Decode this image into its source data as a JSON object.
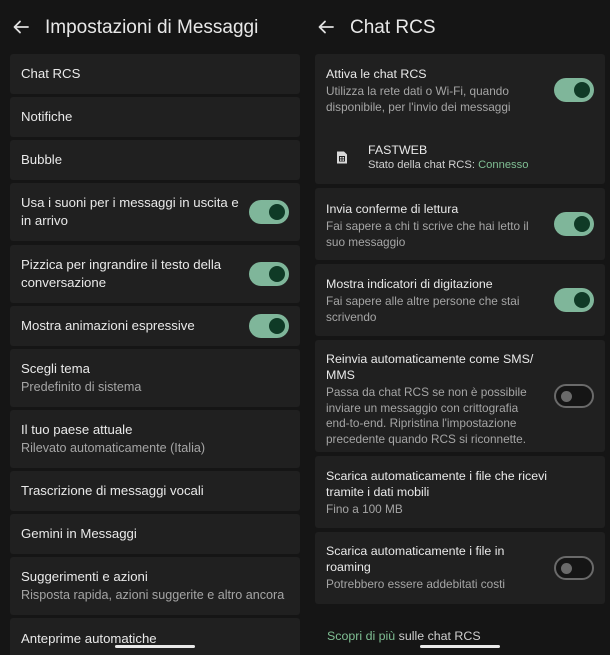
{
  "left": {
    "title": "Impostazioni di Messaggi",
    "items": [
      {
        "label": "Chat RCS"
      },
      {
        "label": "Notifiche"
      },
      {
        "label": "Bubble"
      },
      {
        "label": "Usa i suoni per i messaggi in uscita e in arrivo",
        "toggle": true
      },
      {
        "label": "Pizzica per ingrandire il testo della conversazione",
        "toggle": true
      },
      {
        "label": "Mostra animazioni espressive",
        "toggle": true
      },
      {
        "label": "Scegli tema",
        "sub": "Predefinito di sistema"
      },
      {
        "label": "Il tuo paese attuale",
        "sub": "Rilevato automaticamente (Italia)"
      },
      {
        "label": "Trascrizione di messaggi vocali"
      },
      {
        "label": "Gemini in Messaggi"
      },
      {
        "label": "Suggerimenti e azioni",
        "sub": "Risposta rapida, azioni suggerite e altro ancora"
      },
      {
        "label": "Anteprime automatiche"
      }
    ]
  },
  "right": {
    "title": "Chat RCS",
    "items": [
      {
        "label": "Attiva le chat RCS",
        "sub": "Utilizza la rete dati o Wi-Fi, quando disponibile, per l'invio dei messaggi",
        "toggle": true
      },
      {
        "carrier": "FASTWEB",
        "status_prefix": "Stato della chat RCS:",
        "status_value": "Connesso"
      },
      {
        "label": "Invia conferme di lettura",
        "sub": "Fai sapere a chi ti scrive che hai letto il suo messaggio",
        "toggle": true
      },
      {
        "label": "Mostra indicatori di digitazione",
        "sub": "Fai sapere alle altre persone che stai scrivendo",
        "toggle": true
      },
      {
        "label": "Reinvia automaticamente come SMS/ MMS",
        "sub": "Passa da chat RCS se non è possibile inviare un messaggio con crittografia end-to-end. Ripristina l'impostazione precedente quando RCS si riconnette.",
        "toggle": false
      },
      {
        "label": "Scarica automaticamente i file che ricevi tramite i dati mobili",
        "sub": "Fino a 100 MB"
      },
      {
        "label": "Scarica automaticamente i file in roaming",
        "sub": "Potrebbero essere addebitati costi",
        "toggle": false
      }
    ],
    "link": {
      "highlight": "Scopri di più",
      "rest": "sulle chat RCS"
    }
  },
  "colors": {
    "accent": "#7fb69a",
    "background": "#151515",
    "card": "#202020"
  },
  "icons": {
    "back": "arrow-left-icon",
    "sim": "sim-card-icon"
  }
}
